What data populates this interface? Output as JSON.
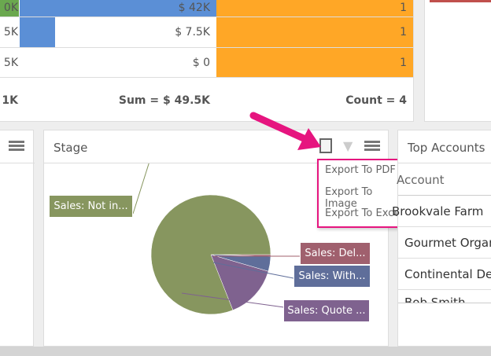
{
  "grid": {
    "rows": [
      {
        "c1": "0K",
        "c2": "$ 42K",
        "c3": "1",
        "bar_fraction": 1.0
      },
      {
        "c1": "5K",
        "c2": "$ 7.5K",
        "c3": "1",
        "bar_fraction": 0.18
      },
      {
        "c1": "5K",
        "c2": "$ 0",
        "c3": "1",
        "bar_fraction": 0
      }
    ],
    "footer": {
      "c1": "1K",
      "c2": "Sum = $ 49.5K",
      "c3": "Count = 4"
    },
    "colors": {
      "green": "#6aa84f",
      "blue": "#5b8fd6",
      "orange": "#ffa726"
    }
  },
  "stage_panel": {
    "title": "Stage",
    "menu": [
      "Export To PDF",
      "Export To Image",
      "Export To Excel"
    ],
    "menu_border": "#e6157f"
  },
  "chart_data": {
    "type": "pie",
    "slices": [
      {
        "label": "Sales: Not in...",
        "value": 81,
        "color": "#87965f"
      },
      {
        "label": "Sales: Del...",
        "value": 0.5,
        "color": "#a0606e"
      },
      {
        "label": "Sales: With...",
        "value": 4,
        "color": "#5f6e9a"
      },
      {
        "label": "Sales: Quote ...",
        "value": 14.5,
        "color": "#7f628f"
      }
    ]
  },
  "top_accounts": {
    "title": "Top Accounts",
    "column": "Account",
    "rows": [
      "Brookvale Farm",
      "Gourmet Organ",
      "Continental De",
      "Bob Smith"
    ]
  }
}
